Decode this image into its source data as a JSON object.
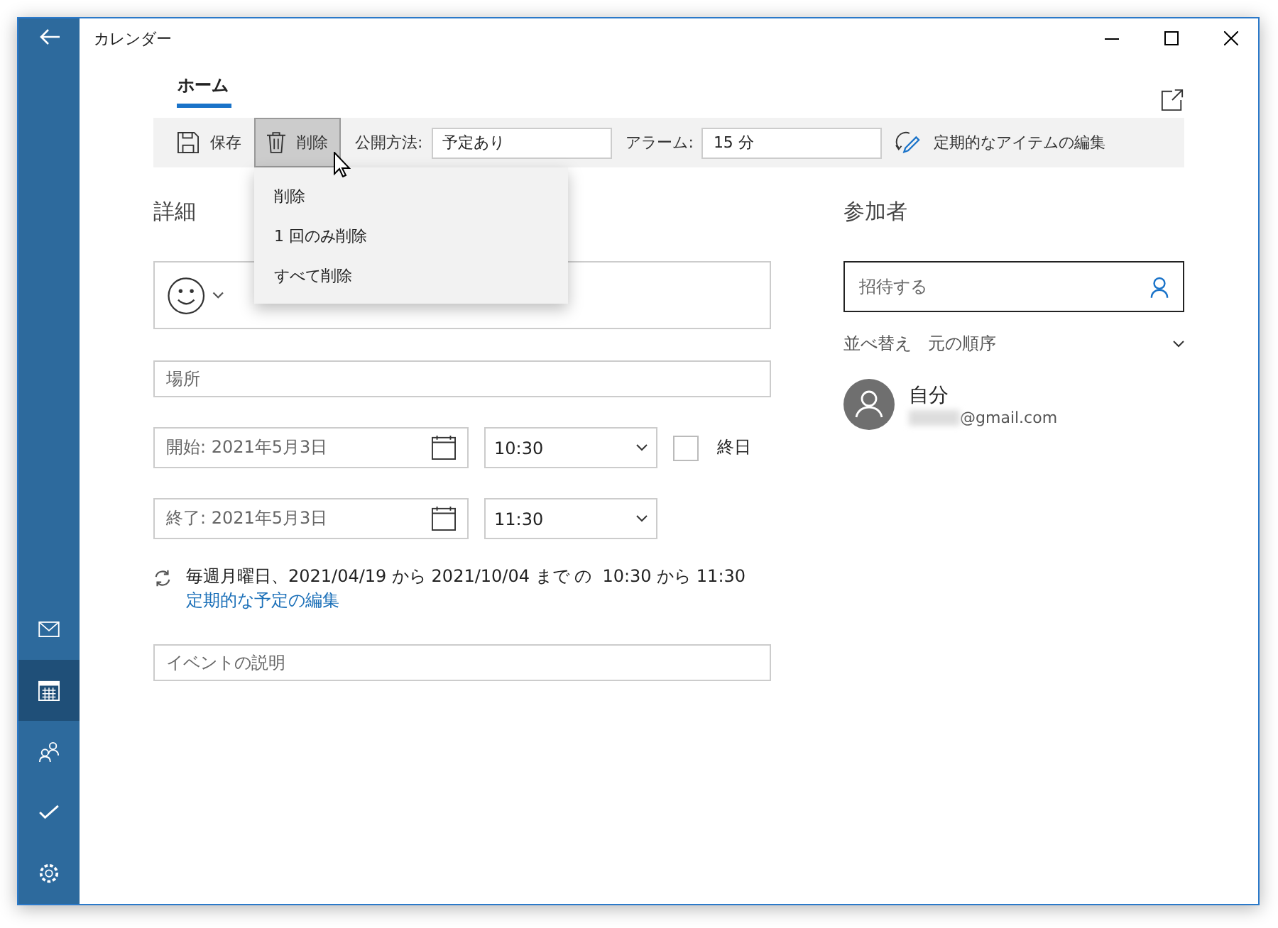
{
  "window": {
    "title": "カレンダー"
  },
  "sidebar": {
    "items": [
      {
        "kind": "mail",
        "selected": false
      },
      {
        "kind": "calendar",
        "selected": true
      },
      {
        "kind": "people",
        "selected": false
      },
      {
        "kind": "todo",
        "selected": false
      },
      {
        "kind": "settings",
        "selected": false
      }
    ]
  },
  "tabs": [
    {
      "label": "ホーム",
      "selected": true
    }
  ],
  "toolbar": {
    "save": "保存",
    "delete": {
      "label": "削除",
      "pressed": true
    },
    "visibility_label": "公開方法:",
    "visibility_value": "予定あり",
    "alarm_label": "アラーム:",
    "alarm_value": "15 分",
    "edit_series": "定期的なアイテムの編集"
  },
  "delete_menu": [
    "削除",
    "1 回のみ削除",
    "すべて削除"
  ],
  "details": {
    "heading": "詳細",
    "location_placeholder": "場所",
    "start": {
      "date": "開始: 2021年5月3日",
      "time": "10:30"
    },
    "end": {
      "date": "終了: 2021年5月3日",
      "time": "11:30"
    },
    "all_day": {
      "label": "終日",
      "checked": false
    },
    "recurrence": "毎週月曜日、2021/04/19 から 2021/10/04 まで の  10:30 から 11:30",
    "recurrence_link": "定期的な予定の編集",
    "description_placeholder": "イベントの説明"
  },
  "attendees": {
    "heading": "参加者",
    "invite_placeholder": "招待する",
    "sort_label": "並べ替え",
    "sort_value": "元の順序",
    "people": [
      {
        "name": "自分",
        "email": "@gmail.com"
      }
    ]
  }
}
